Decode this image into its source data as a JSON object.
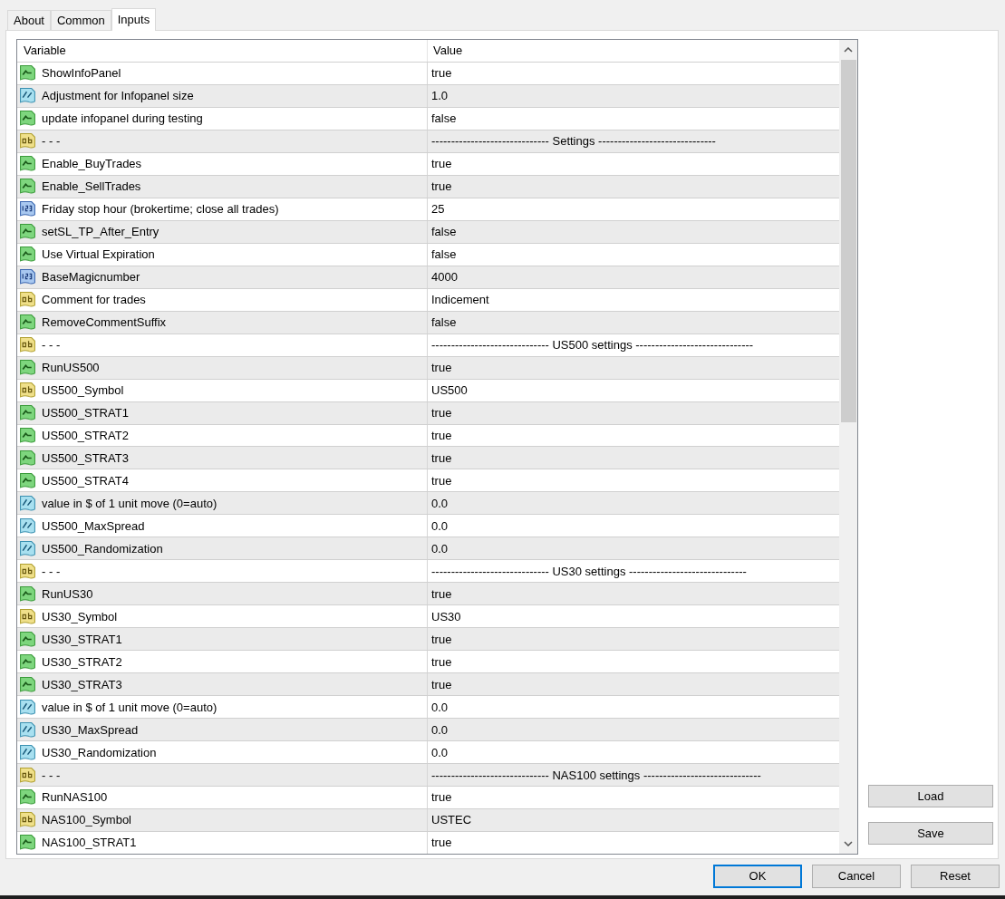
{
  "tabs": [
    {
      "label": "About",
      "selected": false
    },
    {
      "label": "Common",
      "selected": false
    },
    {
      "label": "Inputs",
      "selected": true
    }
  ],
  "table": {
    "columns": [
      "Variable",
      "Value"
    ],
    "rows": [
      {
        "kind": "bool",
        "variable": "ShowInfoPanel",
        "value": "true"
      },
      {
        "kind": "double",
        "variable": "Adjustment for Infopanel size",
        "value": "1.0"
      },
      {
        "kind": "bool",
        "variable": "update infopanel during testing",
        "value": "false"
      },
      {
        "kind": "string",
        "variable": "- - -",
        "value": "------------------------------ Settings ------------------------------"
      },
      {
        "kind": "bool",
        "variable": "Enable_BuyTrades",
        "value": "true"
      },
      {
        "kind": "bool",
        "variable": "Enable_SellTrades",
        "value": "true"
      },
      {
        "kind": "int",
        "variable": "Friday stop hour (brokertime; close all trades)",
        "value": "25"
      },
      {
        "kind": "bool",
        "variable": "setSL_TP_After_Entry",
        "value": "false"
      },
      {
        "kind": "bool",
        "variable": "Use Virtual Expiration",
        "value": "false"
      },
      {
        "kind": "int",
        "variable": "BaseMagicnumber",
        "value": "4000"
      },
      {
        "kind": "string",
        "variable": "Comment for trades",
        "value": "Indicement"
      },
      {
        "kind": "bool",
        "variable": "RemoveCommentSuffix",
        "value": "false"
      },
      {
        "kind": "string",
        "variable": "- - -",
        "value": "------------------------------ US500 settings ------------------------------"
      },
      {
        "kind": "bool",
        "variable": "RunUS500",
        "value": "true"
      },
      {
        "kind": "string",
        "variable": "US500_Symbol",
        "value": "US500"
      },
      {
        "kind": "bool",
        "variable": "US500_STRAT1",
        "value": "true"
      },
      {
        "kind": "bool",
        "variable": "US500_STRAT2",
        "value": "true"
      },
      {
        "kind": "bool",
        "variable": "US500_STRAT3",
        "value": "true"
      },
      {
        "kind": "bool",
        "variable": "US500_STRAT4",
        "value": "true"
      },
      {
        "kind": "double",
        "variable": "value in $ of 1 unit move (0=auto)",
        "value": "0.0"
      },
      {
        "kind": "double",
        "variable": "US500_MaxSpread",
        "value": "0.0"
      },
      {
        "kind": "double",
        "variable": "US500_Randomization",
        "value": "0.0"
      },
      {
        "kind": "string",
        "variable": "- - -",
        "value": "------------------------------ US30 settings ------------------------------"
      },
      {
        "kind": "bool",
        "variable": "RunUS30",
        "value": "true"
      },
      {
        "kind": "string",
        "variable": "US30_Symbol",
        "value": "US30"
      },
      {
        "kind": "bool",
        "variable": "US30_STRAT1",
        "value": "true"
      },
      {
        "kind": "bool",
        "variable": "US30_STRAT2",
        "value": "true"
      },
      {
        "kind": "bool",
        "variable": "US30_STRAT3",
        "value": "true"
      },
      {
        "kind": "double",
        "variable": "value in $ of 1 unit move (0=auto)",
        "value": "0.0"
      },
      {
        "kind": "double",
        "variable": "US30_MaxSpread",
        "value": "0.0"
      },
      {
        "kind": "double",
        "variable": "US30_Randomization",
        "value": "0.0"
      },
      {
        "kind": "string",
        "variable": "- - -",
        "value": "------------------------------ NAS100 settings ------------------------------"
      },
      {
        "kind": "bool",
        "variable": "RunNAS100",
        "value": "true"
      },
      {
        "kind": "string",
        "variable": "NAS100_Symbol",
        "value": "USTEC"
      },
      {
        "kind": "bool",
        "variable": "NAS100_STRAT1",
        "value": "true"
      }
    ]
  },
  "side_buttons": [
    "Load",
    "Save"
  ],
  "buttons": [
    {
      "label": "OK",
      "default": true
    },
    {
      "label": "Cancel",
      "default": false
    },
    {
      "label": "Reset",
      "default": false
    }
  ]
}
